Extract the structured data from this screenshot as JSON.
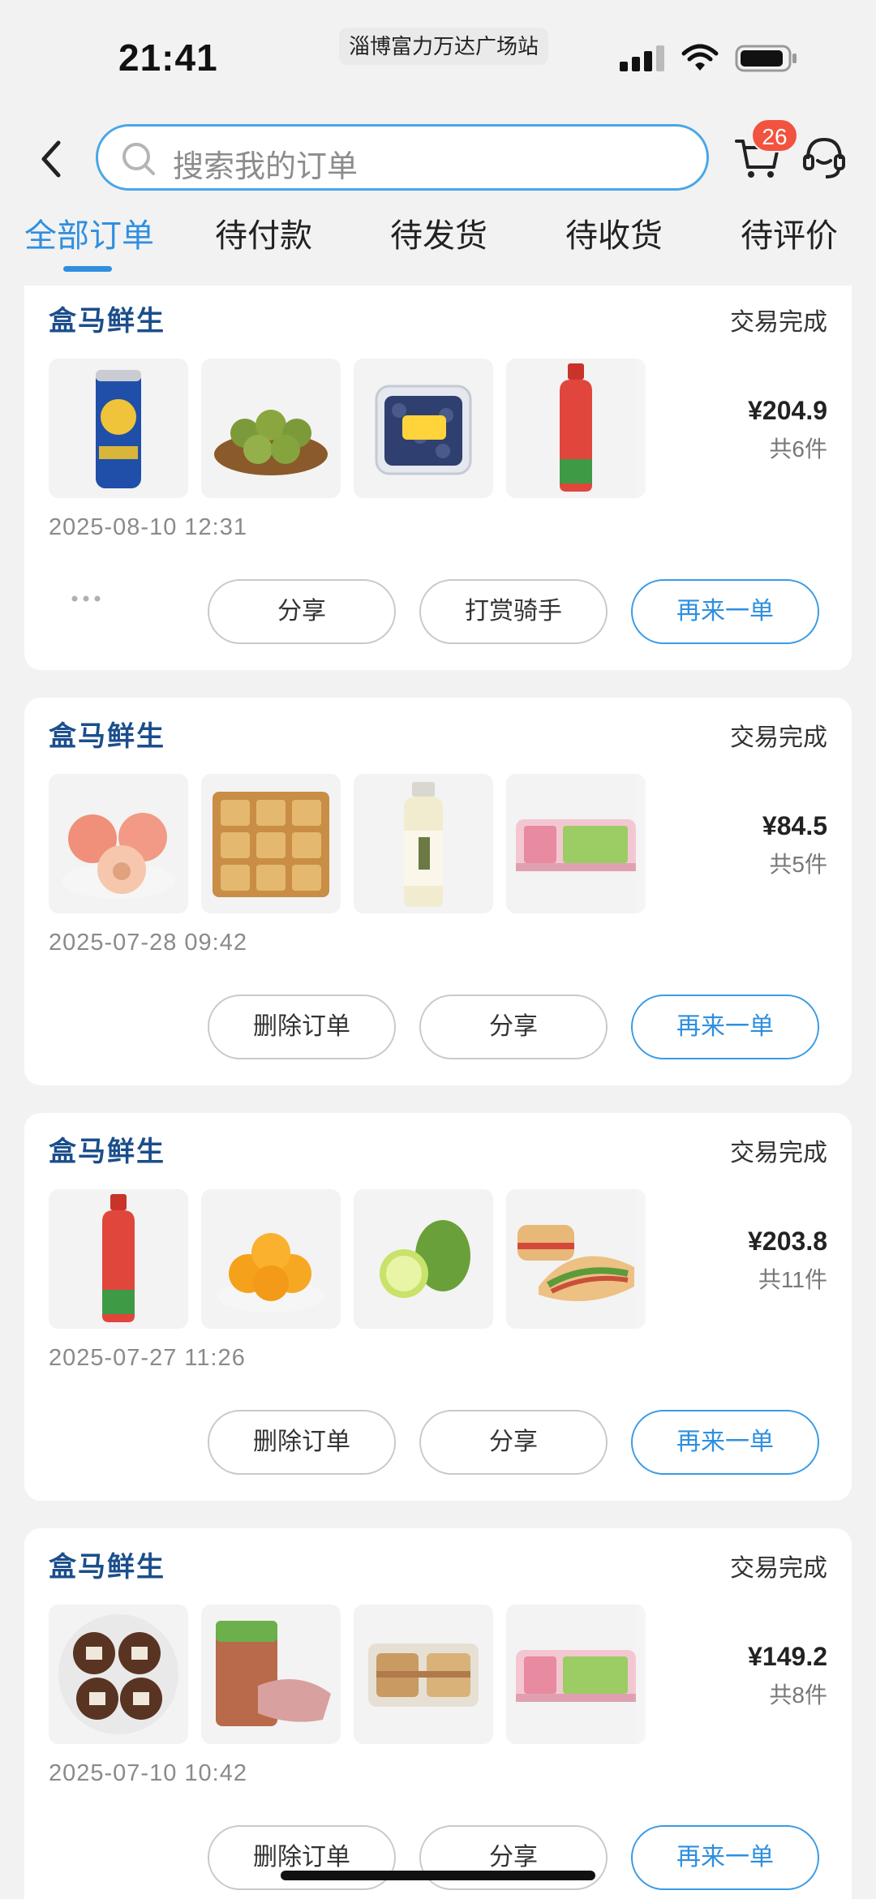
{
  "status_bar": {
    "time": "21:41",
    "location": "淄博富力万达广场站"
  },
  "header": {
    "search_placeholder": "搜索我的订单",
    "cart_badge": "26"
  },
  "tabs": [
    "全部订单",
    "待付款",
    "待发货",
    "待收货",
    "待评价"
  ],
  "active_tab": 0,
  "orders": [
    {
      "store": "盒马鲜生",
      "status": "交易完成",
      "price": "¥204.9",
      "count": "共6件",
      "date": "2025-08-10 12:31",
      "items": [
        "beer-can",
        "kiwi",
        "blueberries",
        "watermelon-juice"
      ],
      "buttons": [
        "分享",
        "打赏骑手",
        "再来一单"
      ],
      "has_more": true
    },
    {
      "store": "盒马鲜生",
      "status": "交易完成",
      "price": "¥84.5",
      "count": "共5件",
      "date": "2025-07-28 09:42",
      "items": [
        "peaches",
        "mooncakes",
        "tea-bottle",
        "cake-pack"
      ],
      "buttons": [
        "删除订单",
        "分享",
        "再来一单"
      ],
      "has_more": false
    },
    {
      "store": "盒马鲜生",
      "status": "交易完成",
      "price": "¥203.8",
      "count": "共11件",
      "date": "2025-07-27 11:26",
      "items": [
        "watermelon-juice",
        "oranges",
        "limes",
        "sandwich"
      ],
      "buttons": [
        "删除订单",
        "分享",
        "再来一单"
      ],
      "has_more": false
    },
    {
      "store": "盒马鲜生",
      "status": "交易完成",
      "price": "¥149.2",
      "count": "共8件",
      "date": "2025-07-10 10:42",
      "items": [
        "chocolate-rolls",
        "sliced-meat",
        "sandwich-box",
        "cake-pack"
      ],
      "buttons": [
        "删除订单",
        "分享",
        "再来一单"
      ],
      "has_more": false
    }
  ]
}
